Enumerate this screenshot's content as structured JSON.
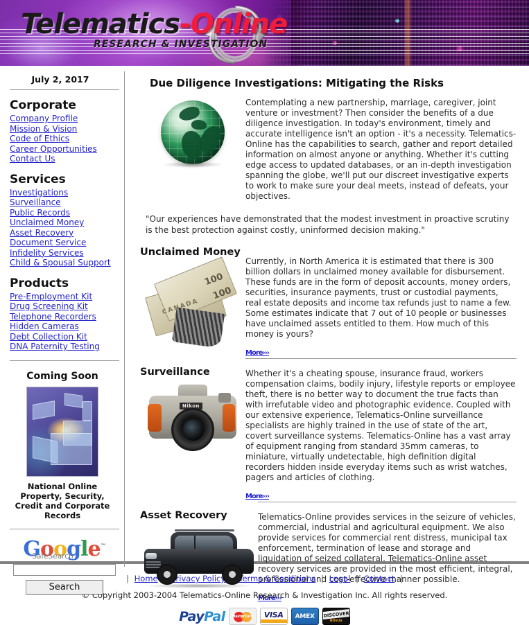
{
  "header": {
    "logo_primary": "Telematics",
    "logo_dash": "-",
    "logo_secondary": "Online",
    "logo_subtitle": "RESEARCH & INVESTIGATION",
    "arrows_icon": "recycle-arrows-icon",
    "circuit_image_alt": "circuit-board-photo",
    "accent_red": "#f01c3c",
    "accent_purple": "#8e35b8"
  },
  "sidebar": {
    "date": "July 2, 2017",
    "sections": [
      {
        "heading": "Corporate",
        "links": [
          "Company Profile",
          "Mission & Vision",
          "Code of Ethics",
          "Career Opportunities",
          "Contact Us"
        ]
      },
      {
        "heading": "Services",
        "links": [
          "Investigations",
          "Surveillance",
          "Public Records",
          "Unclaimed Money",
          "Asset Recovery",
          "Document Service",
          "Infidelity Services",
          "Child & Spousal Support"
        ]
      },
      {
        "heading": "Products",
        "links": [
          "Pre-Employment Kit",
          "Drug Screening Kit",
          "Telephone Recorders",
          "Hidden Cameras",
          "Debt Collection Kit",
          "DNA Paternity Testing"
        ]
      }
    ],
    "coming_soon": {
      "title": "Coming Soon",
      "image_alt": "hands-holding-light-technology-image",
      "caption": "National Online Property, Security, Credit and Corporate Records"
    },
    "google_search": {
      "logo_letters": [
        "G",
        "o",
        "o",
        "g",
        "l",
        "e"
      ],
      "trademark": "™",
      "sublabel": "SafeSearch",
      "input_value": "",
      "input_placeholder": "",
      "button_label": "Search"
    }
  },
  "main": {
    "page_title": "Due Diligence Investigations:  Mitigating the Risks",
    "intro": {
      "image_alt": "green-globe-image",
      "body": "Contemplating a new partnership, marriage, caregiver, joint venture or investment? Then consider the benefits of a due diligence investigation. In today's environment, timely and accurate intelligence isn't an option - it's a necessity. Telematics-Online has the capabilities to search, gather and report detailed information on almost anyone or anything. Whether it's cutting edge access to updated databases, or an in-depth investigation spanning the globe, we'll put our discreet investigative experts to work to make sure your deal meets, instead of defeats, your objectives.",
      "quote": "\"Our experiences have demonstrated that the modest investment in proactive scrutiny is the best protection against costly, uninformed decision making.\""
    },
    "sections": [
      {
        "heading": "Unclaimed Money",
        "image_alt": "canadian-banknotes-image",
        "body": "Currently, in North America it is estimated that there is 300 billion dollars in unclaimed money available for disbursement. These funds are in the form of deposit accounts, money orders, securities, insurance payments, trust or custodial payments, real estate deposits and income tax refunds just to name a few. Some estimates indicate that 7 out of 10 people or businesses have unclaimed assets entitled to them. How much of this money is yours?",
        "more_label": "More",
        "more_chevrons": "›››"
      },
      {
        "heading": "Surveillance",
        "image_alt": "nikon-slr-camera-image",
        "body": "Whether it's a cheating spouse, insurance fraud, workers compensation claims, bodily injury, lifestyle reports or employee theft, there is no better way to document the true facts than with irrefutable video and photographic evidence. Coupled with our extensive experience, Telematics-Online surveillance specialists are highly trained in the use of state of the art, covert surveillance systems. Telematics-Online has a vast array of equipment ranging from standard 35mm cameras, to miniature, virtually undetectable, high definition digital recorders hidden inside everyday items such as wrist watches, pagers and articles of clothing.",
        "more_label": "More",
        "more_chevrons": "›››"
      },
      {
        "heading": "Asset Recovery",
        "image_alt": "black-suv-vehicle-image",
        "body": "Telematics-Online provides services in the seizure of vehicles, commercial, industrial and agricultural equipment. We also provide services for commercial rent distress, municipal tax enforcement, termination of lease and storage and liquidation of seized collateral. Telematics-Online asset recovery services are provided in the most efficient, integral, professional and cost-effective manner possible.",
        "more_label": "More",
        "more_chevrons": "›››"
      }
    ]
  },
  "footer": {
    "separator": "|",
    "links": [
      "Home",
      "Privacy Policy",
      "Terms & Conditions",
      "Legal",
      "Contact"
    ],
    "copyright": "© Copyright 2003-2004 Telematics-Online Research & Investigation Inc. All rights reserved.",
    "payment_methods": [
      {
        "name": "PayPal",
        "part1": "Pay",
        "part2": "Pal"
      },
      {
        "name": "MasterCard",
        "label": "MasterCard"
      },
      {
        "name": "VISA",
        "label": "VISA"
      },
      {
        "name": "AMEX",
        "label": "AMEX"
      },
      {
        "name": "DISCOVER",
        "label": "DISCOVER",
        "sublabel": "NOVUS"
      }
    ]
  }
}
